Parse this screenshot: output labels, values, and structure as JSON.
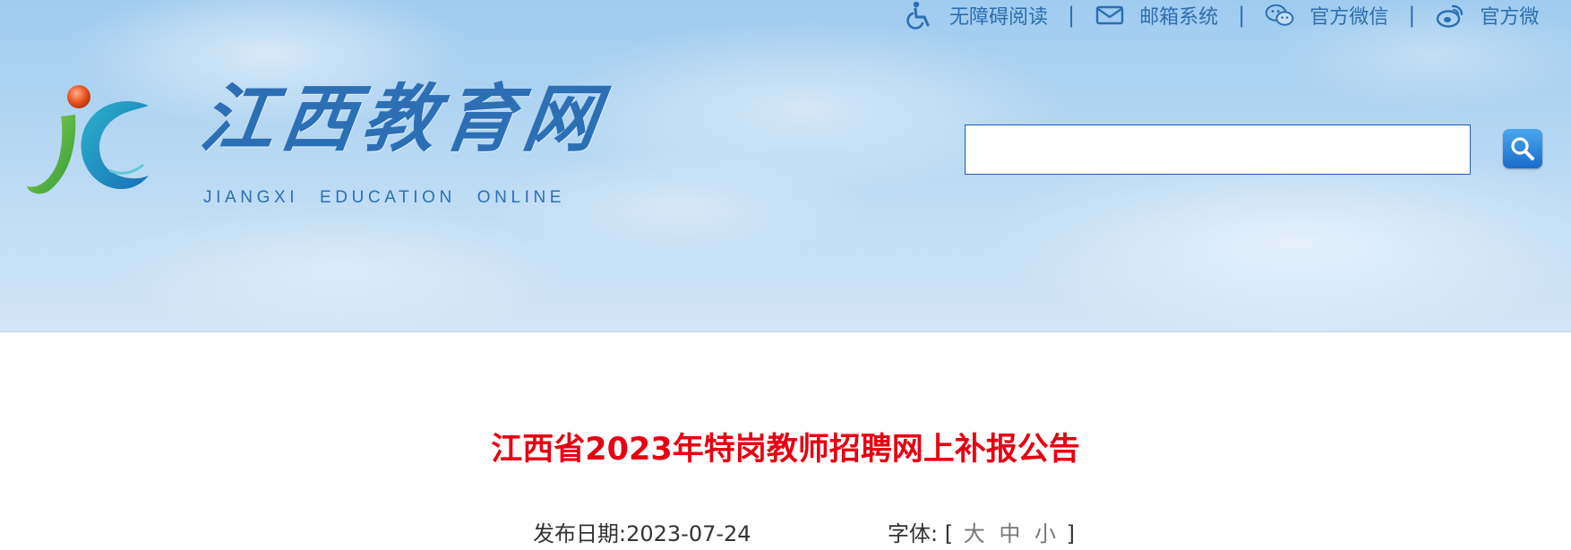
{
  "header": {
    "top_links": [
      {
        "label": "无障碍阅读",
        "icon": "wheelchair-icon"
      },
      {
        "label": "邮箱系统",
        "icon": "mail-icon"
      },
      {
        "label": "官方微信",
        "icon": "wechat-icon"
      },
      {
        "label": "官方微",
        "icon": "weibo-icon"
      }
    ],
    "separator": "|",
    "brand_cn": "江西教育网",
    "brand_en": "JIANGXI EDUCATION ONLINE",
    "search": {
      "value": "",
      "placeholder": ""
    }
  },
  "article": {
    "title": "江西省2023年特岗教师招聘网上补报公告",
    "date_label": "发布日期:",
    "date": "2023-07-24",
    "font_label": "字体:",
    "bracket_open": "[",
    "bracket_close": "]",
    "font_sizes": [
      "大",
      "中",
      "小"
    ]
  },
  "colors": {
    "link_blue": "#2c6fb0",
    "title_red": "#e60012",
    "search_border": "#1e5bb5"
  }
}
